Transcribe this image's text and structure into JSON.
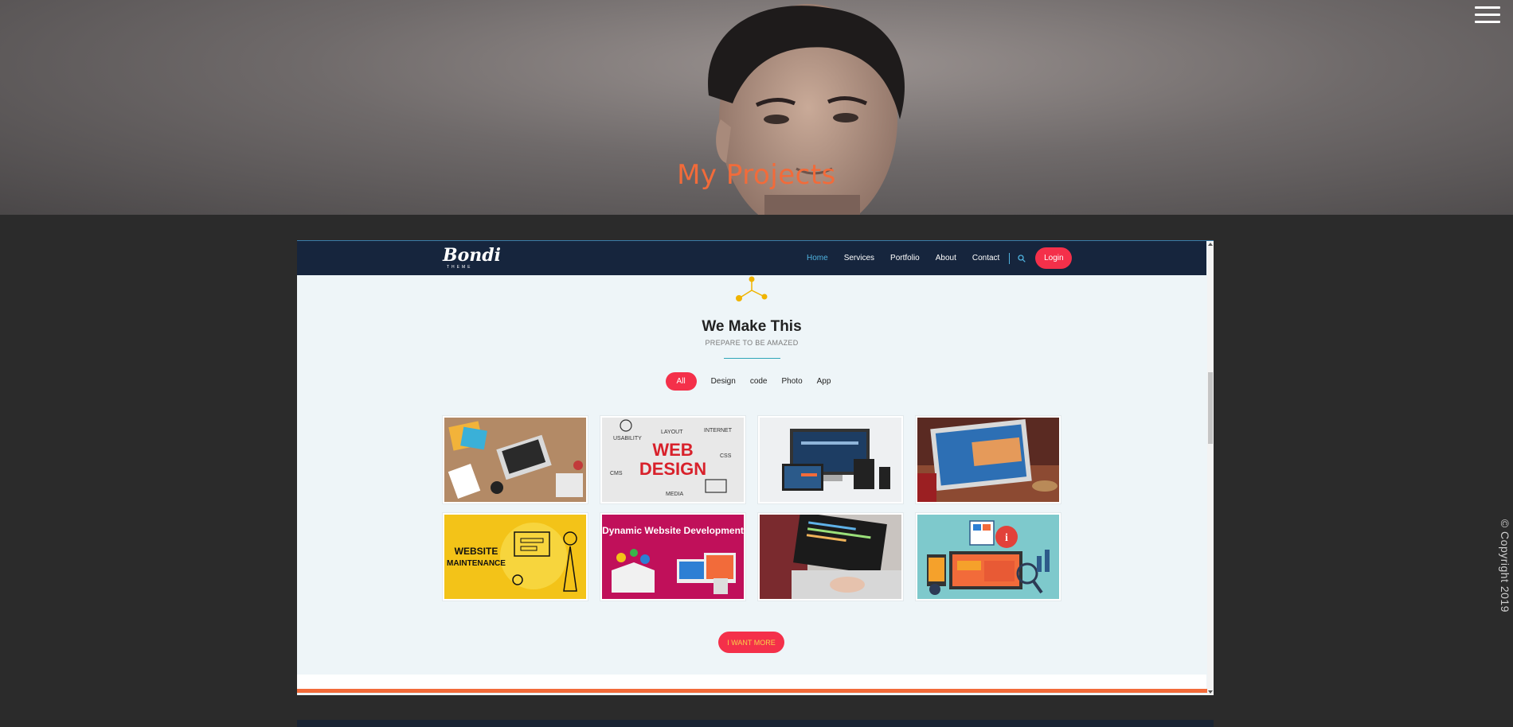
{
  "hero": {
    "title": "My Projects"
  },
  "navbar": {
    "logo": "Bondi",
    "logo_sub": "THEME",
    "links": [
      "Home",
      "Services",
      "Portfolio",
      "About",
      "Contact"
    ],
    "login_label": "Login"
  },
  "section": {
    "title": "We Make This",
    "subtitle": "PREPARE TO BE AMAZED",
    "filters": [
      "All",
      "Design",
      "code",
      "Photo",
      "App"
    ]
  },
  "portfolio": {
    "tiles": [
      {
        "caption": ""
      },
      {
        "caption": "WEB DESIGN"
      },
      {
        "caption": ""
      },
      {
        "caption": ""
      },
      {
        "caption": "WEBSITE MAINTENANCE"
      },
      {
        "caption": "Dynamic Website Development"
      },
      {
        "caption": ""
      },
      {
        "caption": ""
      }
    ]
  },
  "more_button": "I WANT MORE",
  "copyright": "© Copyright 2019",
  "colors": {
    "accent": "#f4304a",
    "orange": "#f26b3a",
    "navy": "#16253d",
    "teal": "#2fa6b8"
  }
}
